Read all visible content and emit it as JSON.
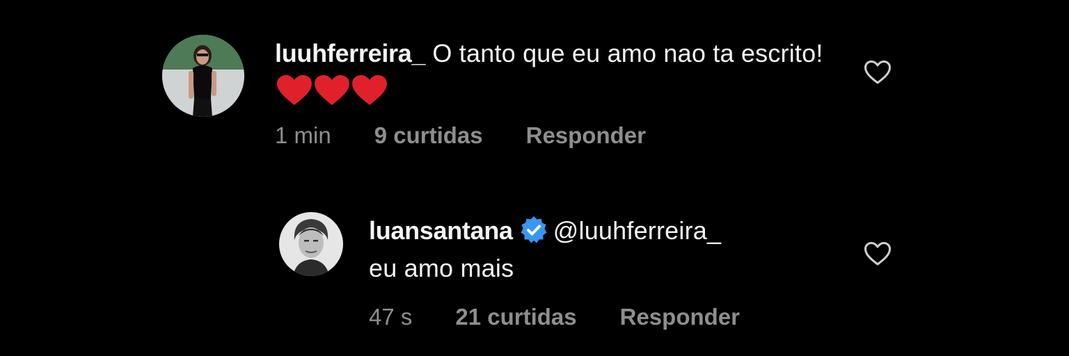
{
  "comments": [
    {
      "username": "luuhferreira_",
      "text_before": " O tanto que eu amo nao ta escrito! ",
      "emoji": [
        "red-heart",
        "red-heart",
        "red-heart"
      ],
      "time": "1 min",
      "likes": "9 curtidas",
      "reply_label": "Responder",
      "verified": false
    },
    {
      "username": "luansantana",
      "mention": "@luuhferreira_",
      "text": "eu amo mais",
      "time": "47 s",
      "likes": "21 curtidas",
      "reply_label": "Responder",
      "verified": true
    }
  ],
  "colors": {
    "background": "#000000",
    "text": "#f5f5f5",
    "secondary": "#8e8e8e",
    "verified_blue": "#3897f0",
    "emoji_red": "#e0212b"
  },
  "icons": {
    "like": "heart-outline-icon",
    "verified": "verified-badge-icon",
    "emoji": "red-heart-emoji"
  }
}
